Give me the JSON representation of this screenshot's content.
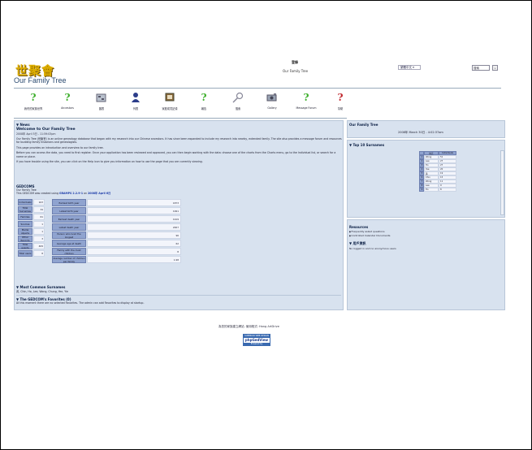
{
  "header": {
    "logo_text": "世聚會",
    "site_title": "Our Family Tree",
    "login_label": "登錄",
    "tree_label": "Our Family Tree",
    "language_select": "繁體中文",
    "search_placeholder": "搜索",
    "go_label": "»"
  },
  "toolbar": [
    {
      "label": "我們的家族世界",
      "icon": "help-question-icon"
    },
    {
      "label": "Ancestors",
      "icon": "help-question-icon"
    },
    {
      "label": "圖表",
      "icon": "chart-icon"
    },
    {
      "label": "列表",
      "icon": "individual-icon"
    },
    {
      "label": "家庭成員記錄",
      "icon": "family-icon"
    },
    {
      "label": "報告",
      "icon": "help-question-icon"
    },
    {
      "label": "搜索",
      "icon": "search-icon"
    },
    {
      "label": "Gallery",
      "icon": "gallery-icon"
    },
    {
      "label": "Message Forum",
      "icon": "help-question-icon"
    },
    {
      "label": "幫助",
      "icon": "help-question-icon"
    }
  ],
  "news": {
    "heading": "News",
    "title": "Welcome to Our Family Tree",
    "date": "2008年 April 5日 - 11:59:03pm",
    "p1": "Our Family Tree (世聚會) is an online genealogy database that began with my research into our Chinese ancestors. It has since been expanded to include my research into nearby, extended family. The site also provides a message forum and resources for budding family historians and genealogists.",
    "p2": "This page provides an introduction and overview to our family tree.",
    "p3": "Before you can access the data, you need to first register. Once your application has been reviewed and approved, you can then begin working with the data: choose one of the charts from the Charts menu, go to the Individual list, or search for a name or place.",
    "p4": "If you have trouble using the site, you can click on the Help icon to give you information on how to use the page that you are currently viewing."
  },
  "gedcom": {
    "heading": "GEDCOMS",
    "tree": "Our Family Tree",
    "created_prefix": "This GEDCOM was created using",
    "software": "GRAMPS 2.2.9-1",
    "on": "on",
    "date": "2008年 April 6日",
    "left_stats": [
      {
        "k": "Individuals",
        "v": "163"
      },
      {
        "k": "Total Surnames",
        "v": "34"
      },
      {
        "k": "Families",
        "v": "61"
      },
      {
        "k": "Sources",
        "v": "1"
      },
      {
        "k": "Media objects",
        "v": "1"
      },
      {
        "k": "Other Records",
        "v": "3"
      },
      {
        "k": "Total events",
        "v": "469"
      },
      {
        "k": "Total users",
        "v": "8"
      }
    ],
    "mid_stats": [
      {
        "k": "Earliest birth year",
        "v": "1873"
      },
      {
        "k": "Latest birth year",
        "v": "1991"
      },
      {
        "k": "Earliest death year",
        "v": "1919"
      },
      {
        "k": "Latest death year",
        "v": "2007"
      },
      {
        "k": "Person who lived the longest",
        "v": "96"
      },
      {
        "k": "Average age at death",
        "v": "62"
      },
      {
        "k": "Family with the most children",
        "v": "8"
      },
      {
        "k": "Average number of children per family",
        "v": "1.98"
      }
    ]
  },
  "common": {
    "heading": "Most Common Surnames",
    "list": "黃, Chin, Ho, Lee, Wong, Chung, Yee, Yie"
  },
  "favorites": {
    "heading": "The GEDCOM's Favorites (0)",
    "text": "At this moment there are no selected Favorites. The admin can add Favorites to display at startup."
  },
  "side_tree": {
    "heading": "Our Family Tree",
    "datetime": "2008年 March 30日 - 4:02:37am"
  },
  "top_surnames": {
    "heading": "Top 10 Surnames",
    "col_surname": "姓氏",
    "col_count": "Individuals",
    "rows": [
      {
        "n": "1",
        "s": "Wong",
        "c": "51"
      },
      {
        "n": "2",
        "s": "Lee",
        "c": "27"
      },
      {
        "n": "3",
        "s": "Ho",
        "c": "27"
      },
      {
        "n": "4",
        "s": "Yee",
        "c": "20"
      },
      {
        "n": "5",
        "s": "黃",
        "c": "19"
      },
      {
        "n": "6",
        "s": "Chin",
        "c": "15"
      },
      {
        "n": "7",
        "s": "Wong",
        "c": "11"
      },
      {
        "n": "8",
        "s": "Lee",
        "c": "9"
      },
      {
        "n": "9",
        "s": "Ho",
        "c": "8"
      }
    ]
  },
  "resources": {
    "heading": "Resources",
    "items": [
      "Frequently asked questions",
      "Controlled Calendar Documents"
    ]
  },
  "users": {
    "heading": "用戶資訊",
    "text": "No logged in and no anonymous users"
  },
  "footer": {
    "text": "為您的家族建立網站. 使用程式: Hang ArtDrive",
    "badge_top": "SUPERIOR WEB DESIGN",
    "badge_mid": "phpGedView",
    "badge_bot": "Powered by"
  }
}
